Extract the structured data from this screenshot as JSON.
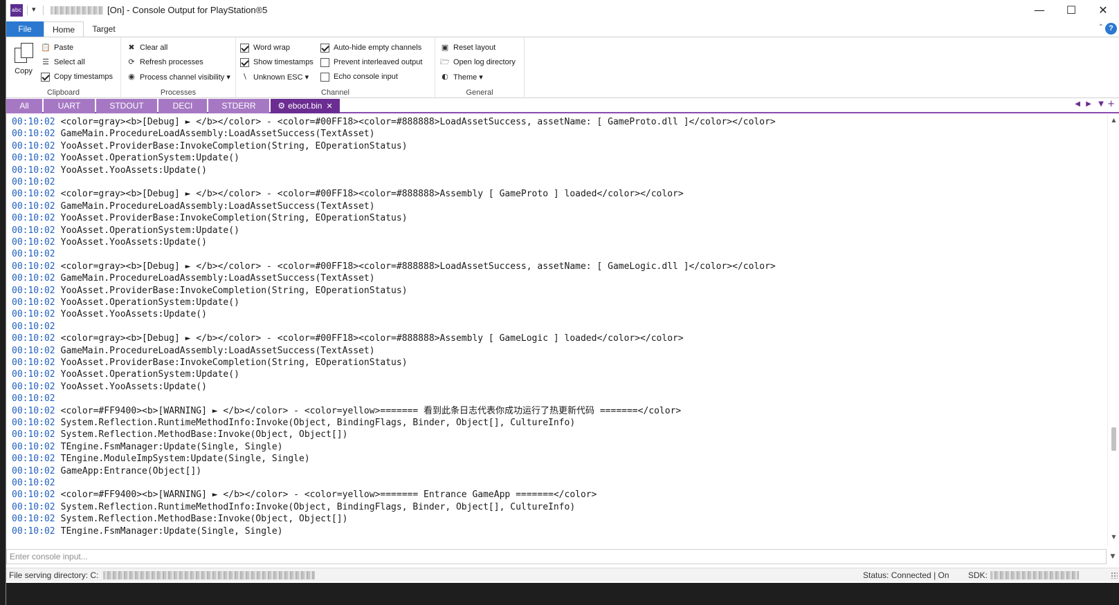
{
  "window": {
    "title": "[On] - Console Output for PlayStation®5",
    "app_icon_text": "abc",
    "minimize_glyph": "—",
    "maximize_glyph": "☐",
    "close_glyph": "✕"
  },
  "ribbon_tabs": [
    "File",
    "Home",
    "Target"
  ],
  "ribbon": {
    "clipboard": {
      "label": "Clipboard",
      "copy": "Copy",
      "paste": "Paste",
      "select_all": "Select all",
      "copy_timestamps": "Copy timestamps",
      "copy_timestamps_checked": true
    },
    "processes": {
      "label": "Processes",
      "clear_all": "Clear all",
      "refresh": "Refresh processes",
      "visibility": "Process channel visibility ▾"
    },
    "channel": {
      "label": "Channel",
      "word_wrap": "Word wrap",
      "word_wrap_checked": true,
      "show_timestamps": "Show timestamps",
      "show_timestamps_checked": true,
      "unknown_esc": "Unknown ESC ▾",
      "auto_hide": "Auto-hide empty channels",
      "auto_hide_checked": true,
      "prevent_interleaved": "Prevent interleaved output",
      "prevent_interleaved_checked": false,
      "echo_input": "Echo console input",
      "echo_input_checked": false
    },
    "general": {
      "label": "General",
      "reset_layout": "Reset layout",
      "open_log": "Open log directory",
      "theme": "Theme ▾"
    }
  },
  "channel_tabs": [
    "All",
    "UART",
    "STDOUT",
    "DECI",
    "STDERR",
    "eboot.bin"
  ],
  "active_channel": "eboot.bin",
  "log_lines": [
    {
      "ts": "00:10:02",
      "msg": "<color=gray><b>[Debug] ► </b></color> - <color=#00FF18><color=#888888>LoadAssetSuccess, assetName: [ GameProto.dll ]</color></color>"
    },
    {
      "ts": "00:10:02",
      "msg": "GameMain.ProcedureLoadAssembly:LoadAssetSuccess(TextAsset)"
    },
    {
      "ts": "00:10:02",
      "msg": "YooAsset.ProviderBase:InvokeCompletion(String, EOperationStatus)"
    },
    {
      "ts": "00:10:02",
      "msg": "YooAsset.OperationSystem:Update()"
    },
    {
      "ts": "00:10:02",
      "msg": "YooAsset.YooAssets:Update()"
    },
    {
      "ts": "00:10:02",
      "msg": ""
    },
    {
      "ts": "00:10:02",
      "msg": "<color=gray><b>[Debug] ► </b></color> - <color=#00FF18><color=#888888>Assembly [ GameProto ] loaded</color></color>"
    },
    {
      "ts": "00:10:02",
      "msg": "GameMain.ProcedureLoadAssembly:LoadAssetSuccess(TextAsset)"
    },
    {
      "ts": "00:10:02",
      "msg": "YooAsset.ProviderBase:InvokeCompletion(String, EOperationStatus)"
    },
    {
      "ts": "00:10:02",
      "msg": "YooAsset.OperationSystem:Update()"
    },
    {
      "ts": "00:10:02",
      "msg": "YooAsset.YooAssets:Update()"
    },
    {
      "ts": "00:10:02",
      "msg": ""
    },
    {
      "ts": "00:10:02",
      "msg": "<color=gray><b>[Debug] ► </b></color> - <color=#00FF18><color=#888888>LoadAssetSuccess, assetName: [ GameLogic.dll ]</color></color>"
    },
    {
      "ts": "00:10:02",
      "msg": "GameMain.ProcedureLoadAssembly:LoadAssetSuccess(TextAsset)"
    },
    {
      "ts": "00:10:02",
      "msg": "YooAsset.ProviderBase:InvokeCompletion(String, EOperationStatus)"
    },
    {
      "ts": "00:10:02",
      "msg": "YooAsset.OperationSystem:Update()"
    },
    {
      "ts": "00:10:02",
      "msg": "YooAsset.YooAssets:Update()"
    },
    {
      "ts": "00:10:02",
      "msg": ""
    },
    {
      "ts": "00:10:02",
      "msg": "<color=gray><b>[Debug] ► </b></color> - <color=#00FF18><color=#888888>Assembly [ GameLogic ] loaded</color></color>"
    },
    {
      "ts": "00:10:02",
      "msg": "GameMain.ProcedureLoadAssembly:LoadAssetSuccess(TextAsset)"
    },
    {
      "ts": "00:10:02",
      "msg": "YooAsset.ProviderBase:InvokeCompletion(String, EOperationStatus)"
    },
    {
      "ts": "00:10:02",
      "msg": "YooAsset.OperationSystem:Update()"
    },
    {
      "ts": "00:10:02",
      "msg": "YooAsset.YooAssets:Update()"
    },
    {
      "ts": "00:10:02",
      "msg": ""
    },
    {
      "ts": "00:10:02",
      "msg": "<color=#FF9400><b>[WARNING] ► </b></color> - <color=yellow>======= 看到此条日志代表你成功运行了热更新代码 =======</color>"
    },
    {
      "ts": "00:10:02",
      "msg": "System.Reflection.RuntimeMethodInfo:Invoke(Object, BindingFlags, Binder, Object[], CultureInfo)"
    },
    {
      "ts": "00:10:02",
      "msg": "System.Reflection.MethodBase:Invoke(Object, Object[])"
    },
    {
      "ts": "00:10:02",
      "msg": "TEngine.FsmManager:Update(Single, Single)"
    },
    {
      "ts": "00:10:02",
      "msg": "TEngine.ModuleImpSystem:Update(Single, Single)"
    },
    {
      "ts": "00:10:02",
      "msg": "GameApp:Entrance(Object[])"
    },
    {
      "ts": "00:10:02",
      "msg": ""
    },
    {
      "ts": "00:10:02",
      "msg": "<color=#FF9400><b>[WARNING] ► </b></color> - <color=yellow>======= Entrance GameApp =======</color>"
    },
    {
      "ts": "00:10:02",
      "msg": "System.Reflection.RuntimeMethodInfo:Invoke(Object, BindingFlags, Binder, Object[], CultureInfo)"
    },
    {
      "ts": "00:10:02",
      "msg": "System.Reflection.MethodBase:Invoke(Object, Object[])"
    },
    {
      "ts": "00:10:02",
      "msg": "TEngine.FsmManager:Update(Single, Single)"
    }
  ],
  "console_input": {
    "placeholder": "Enter console input...",
    "value": ""
  },
  "status": {
    "file_serving": "File serving directory: C:",
    "connection": "Status: Connected | On",
    "sdk": "SDK:"
  },
  "colors": {
    "accent_purple": "#6b2d91",
    "tab_purple": "#a678c4",
    "file_blue": "#2b78d0",
    "timestamp_blue": "#1f5fbf"
  }
}
